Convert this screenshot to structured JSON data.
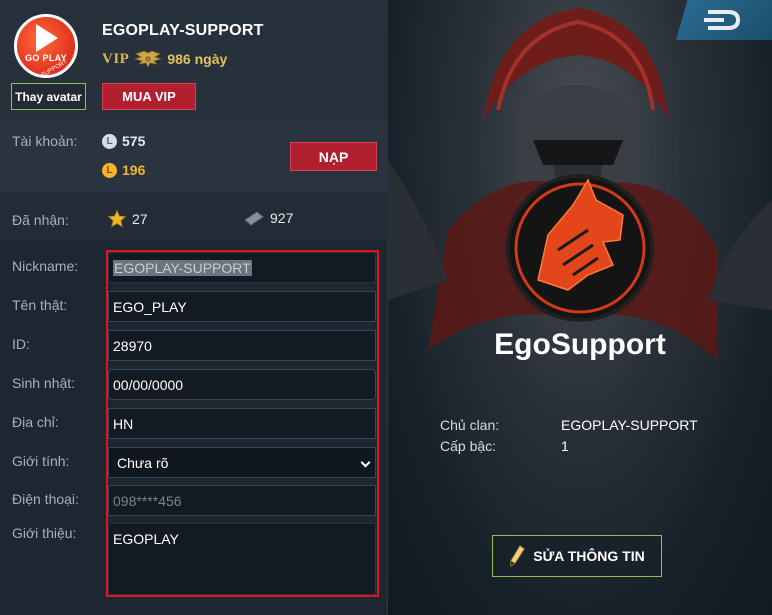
{
  "profile": {
    "username": "EGOPLAY-SUPPORT",
    "vip_label": "VIP",
    "vip_days": "986 ngày",
    "change_avatar": "Thay avatar",
    "buy_vip": "MUA VIP",
    "logo_text": "GO PLAY",
    "logo_subtext": "SUPPORT"
  },
  "account": {
    "label": "Tài khoản:",
    "silver_balance": "575",
    "gold_balance": "196",
    "topup": "NẠP"
  },
  "received": {
    "label": "Đã nhận:",
    "stars": "27",
    "items": "927"
  },
  "form": {
    "nickname_label": "Nickname:",
    "nickname_value": "EGOPLAY-SUPPORT",
    "realname_label": "Tên thật:",
    "realname_value": "EGO_PLAY",
    "id_label": "ID:",
    "id_value": "28970",
    "birthday_label": "Sinh nhật:",
    "birthday_value": "00/00/0000",
    "address_label": "Địa chỉ:",
    "address_value": "HN",
    "gender_label": "Giới tính:",
    "gender_value": "Chưa rõ",
    "phone_label": "Điện thoại:",
    "phone_value": "098****456",
    "bio_label": "Giới thiệu:",
    "bio_value": "EGOPLAY"
  },
  "clan": {
    "name": "EgoSupport",
    "leader_label": "Chủ clan:",
    "leader_value": "EGOPLAY-SUPPORT",
    "rank_label": "Cấp bậc:",
    "rank_value": "1",
    "edit_button": "SỬA THÔNG TIN"
  },
  "colors": {
    "accent_red": "#b1202f",
    "highlight_border": "#e0141e",
    "green_outline": "#8fbf53",
    "gold": "#e2c25c"
  }
}
